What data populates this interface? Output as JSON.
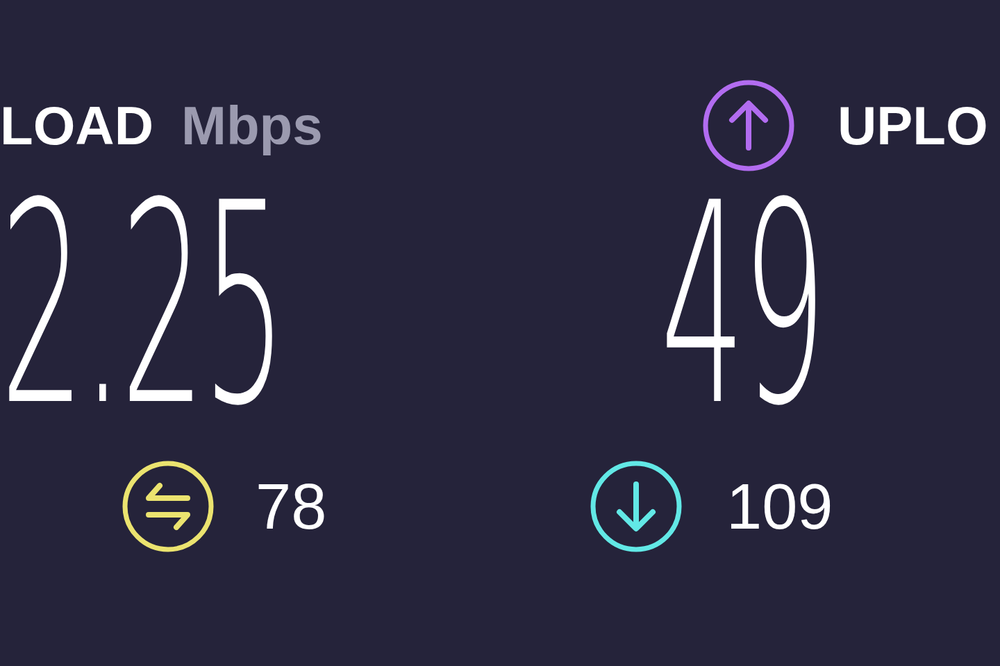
{
  "download": {
    "label": "LOAD",
    "unit": "Mbps",
    "value": "2.25"
  },
  "upload": {
    "label": "UPLO",
    "value": "49"
  },
  "pings": [
    {
      "kind": "jitter",
      "value": "78",
      "color": "#ebe36f"
    },
    {
      "kind": "download",
      "value": "109",
      "color": "#62e8e6"
    }
  ]
}
